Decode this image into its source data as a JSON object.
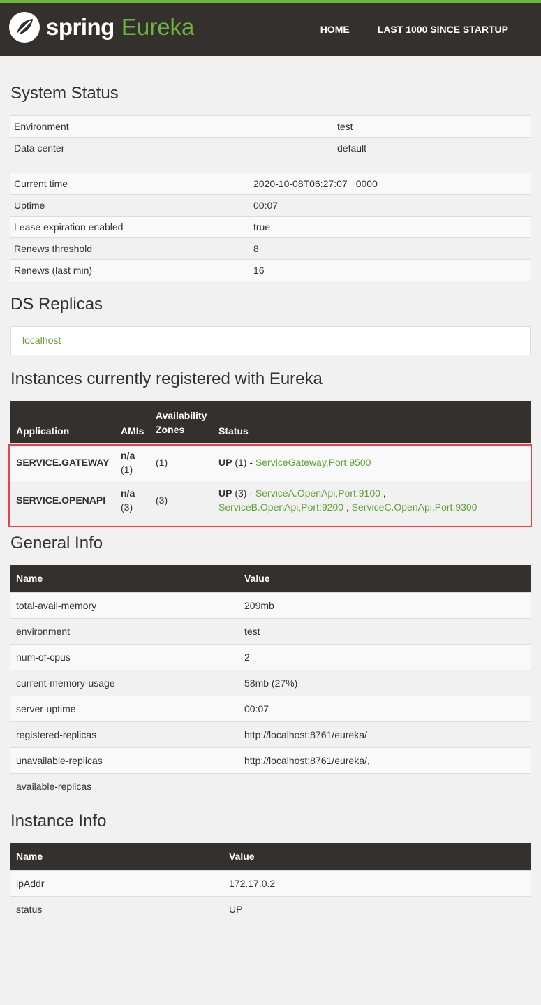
{
  "nav": {
    "brand_spring": "spring",
    "brand_eureka": "Eureka",
    "home": "HOME",
    "last1000": "LAST 1000 SINCE STARTUP"
  },
  "system_status": {
    "title": "System Status",
    "env_rows": [
      {
        "label": "Environment",
        "value": "test"
      },
      {
        "label": "Data center",
        "value": "default"
      }
    ],
    "time_rows": [
      {
        "label": "Current time",
        "value": "2020-10-08T06:27:07 +0000"
      },
      {
        "label": "Uptime",
        "value": "00:07"
      },
      {
        "label": "Lease expiration enabled",
        "value": "true"
      },
      {
        "label": "Renews threshold",
        "value": "8"
      },
      {
        "label": "Renews (last min)",
        "value": "16"
      }
    ]
  },
  "ds_replicas": {
    "title": "DS Replicas",
    "link": "localhost"
  },
  "instances": {
    "title": "Instances currently registered with Eureka",
    "headers": {
      "application": "Application",
      "amis": "AMIs",
      "zones_1": "Availability",
      "zones_2": "Zones",
      "status": "Status"
    },
    "rows": [
      {
        "application": "SERVICE.GATEWAY",
        "amis_1": "n/a",
        "amis_2": "(1)",
        "zones": "(1)",
        "status_up": "UP",
        "status_count": " (1) - ",
        "instance_1": "ServiceGateway,Port:9500"
      },
      {
        "application": "SERVICE.OPENAPI",
        "amis_1": "n/a",
        "amis_2": "(3)",
        "zones": "(3)",
        "status_up": "UP",
        "status_count": " (3) - ",
        "instance_1": "ServiceA.OpenApi,Port:9100",
        "sep_1": " ,",
        "instance_2": "ServiceB.OpenApi,Port:9200",
        "sep_2": " , ",
        "instance_3": "ServiceC.OpenApi,Port:9300"
      }
    ]
  },
  "general_info": {
    "title": "General Info",
    "headers": {
      "name": "Name",
      "value": "Value"
    },
    "rows": [
      {
        "name": "total-avail-memory",
        "value": "209mb"
      },
      {
        "name": "environment",
        "value": "test"
      },
      {
        "name": "num-of-cpus",
        "value": "2"
      },
      {
        "name": "current-memory-usage",
        "value": "58mb (27%)"
      },
      {
        "name": "server-uptime",
        "value": "00:07"
      },
      {
        "name": "registered-replicas",
        "value": "http://localhost:8761/eureka/"
      },
      {
        "name": "unavailable-replicas",
        "value": "http://localhost:8761/eureka/,"
      },
      {
        "name": "available-replicas",
        "value": ""
      }
    ]
  },
  "instance_info": {
    "title": "Instance Info",
    "headers": {
      "name": "Name",
      "value": "Value"
    },
    "rows": [
      {
        "name": "ipAddr",
        "value": "172.17.0.2"
      },
      {
        "name": "status",
        "value": "UP"
      }
    ]
  },
  "colors": {
    "brand_green": "#6db33f",
    "link_green": "#5fa134",
    "dark": "#34302d",
    "highlight_red": "#e8414a"
  }
}
